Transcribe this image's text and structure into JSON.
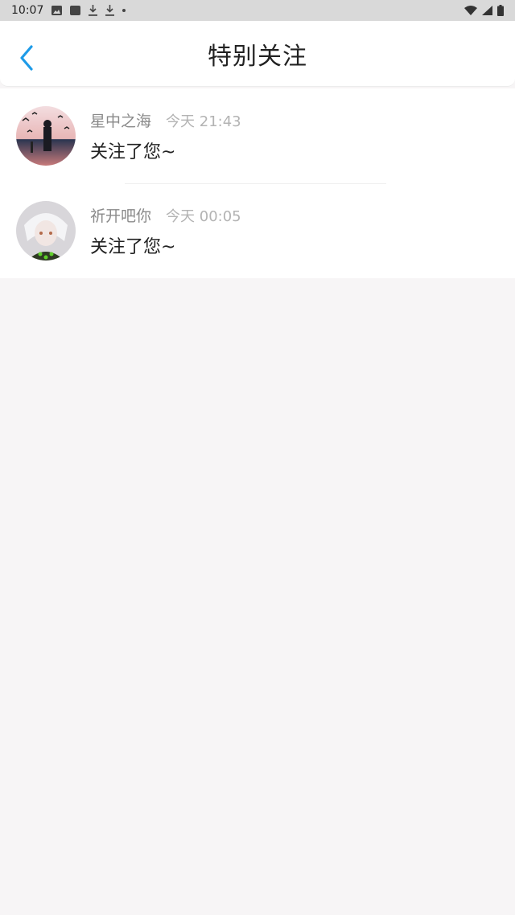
{
  "status_bar": {
    "time": "10:07",
    "icons": [
      "image-icon",
      "square-icon",
      "download-icon",
      "download-icon",
      "dot-icon"
    ],
    "right_icons": [
      "wifi-icon",
      "signal-icon",
      "battery-icon"
    ]
  },
  "header": {
    "back_icon": "chevron-left-icon",
    "title": "特别关注"
  },
  "items": [
    {
      "name": "星中之海",
      "time": "今天 21:43",
      "message": "关注了您~"
    },
    {
      "name": "祈开吧你",
      "time": "今天 00:05",
      "message": "关注了您~"
    }
  ],
  "colors": {
    "accent": "#1e9be8",
    "background": "#f7f5f6"
  }
}
